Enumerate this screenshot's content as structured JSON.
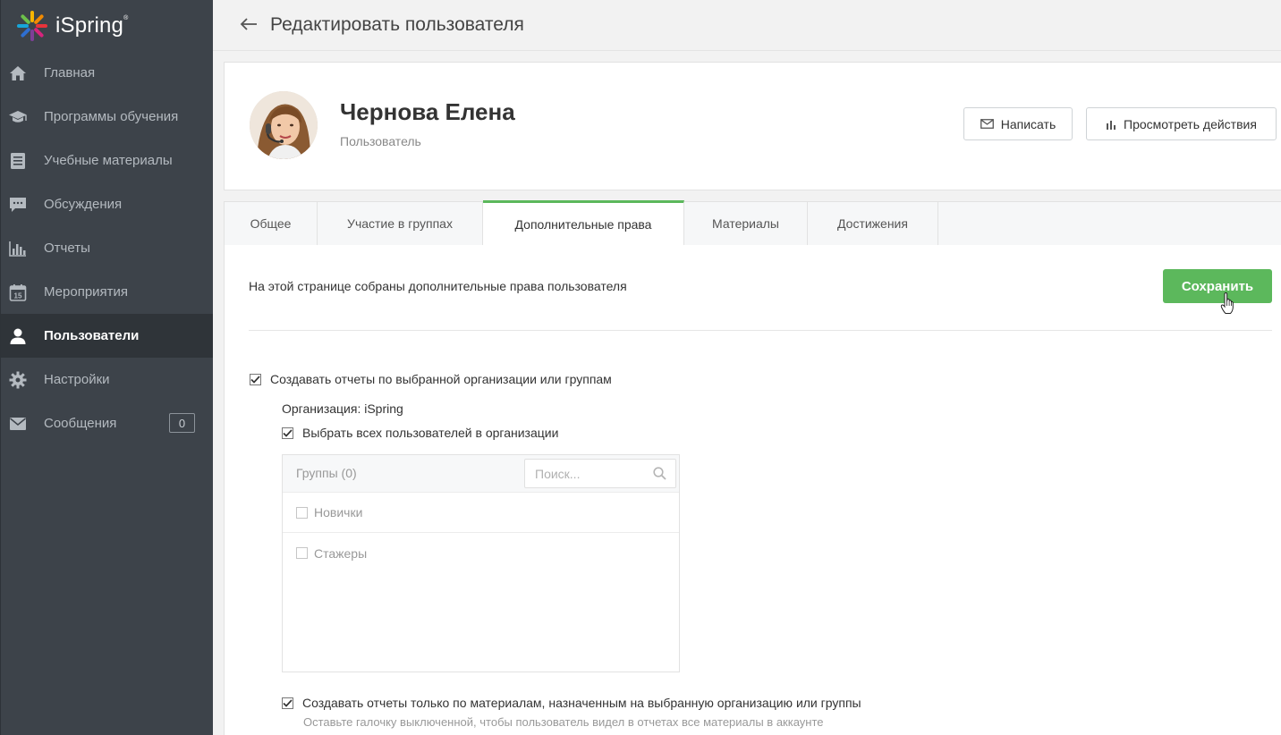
{
  "app": {
    "logo_text": "iSpring"
  },
  "sidebar": {
    "items": [
      {
        "label": "Главная",
        "icon": "home-icon"
      },
      {
        "label": "Программы обучения",
        "icon": "graduation-cap-icon"
      },
      {
        "label": "Учебные материалы",
        "icon": "document-icon"
      },
      {
        "label": "Обсуждения",
        "icon": "chat-icon"
      },
      {
        "label": "Отчеты",
        "icon": "bar-chart-icon"
      },
      {
        "label": "Мероприятия",
        "icon": "calendar-icon"
      },
      {
        "label": "Пользователи",
        "icon": "user-icon",
        "active": true
      },
      {
        "label": "Настройки",
        "icon": "gear-icon"
      },
      {
        "label": "Сообщения",
        "icon": "envelope-icon",
        "badge": "0"
      }
    ]
  },
  "header": {
    "title": "Редактировать пользователя"
  },
  "profile": {
    "name": "Чернова Елена",
    "role": "Пользователь",
    "write_label": "Написать",
    "actions_label": "Просмотреть действия"
  },
  "tabs": [
    {
      "label": "Общее"
    },
    {
      "label": "Участие в группах"
    },
    {
      "label": "Дополнительные права",
      "active": true
    },
    {
      "label": "Материалы"
    },
    {
      "label": "Достижения"
    }
  ],
  "content": {
    "intro": "На этой странице собраны дополнительные права пользователя",
    "save_label": "Сохранить",
    "report_org_label": "Создавать отчеты по выбранной организации или группам",
    "report_org_checked": true,
    "org_label": "Организация: iSpring",
    "select_all_label": "Выбрать всех пользователей в организации",
    "select_all_checked": true,
    "groups_title": "Группы (0)",
    "search_placeholder": "Поиск...",
    "groups": [
      {
        "label": "Новички",
        "checked": false
      },
      {
        "label": "Стажеры",
        "checked": false
      }
    ],
    "assigned_only_label": "Создавать отчеты только по материалам, назначенным на выбранную организацию или группы",
    "assigned_only_checked": true,
    "assigned_only_hint": "Оставьте галочку выключенной, чтобы пользователь видел в отчетах все материалы в аккаунте"
  },
  "colors": {
    "sidebar_bg": "#3d434a",
    "accent_green": "#5cb85c"
  }
}
